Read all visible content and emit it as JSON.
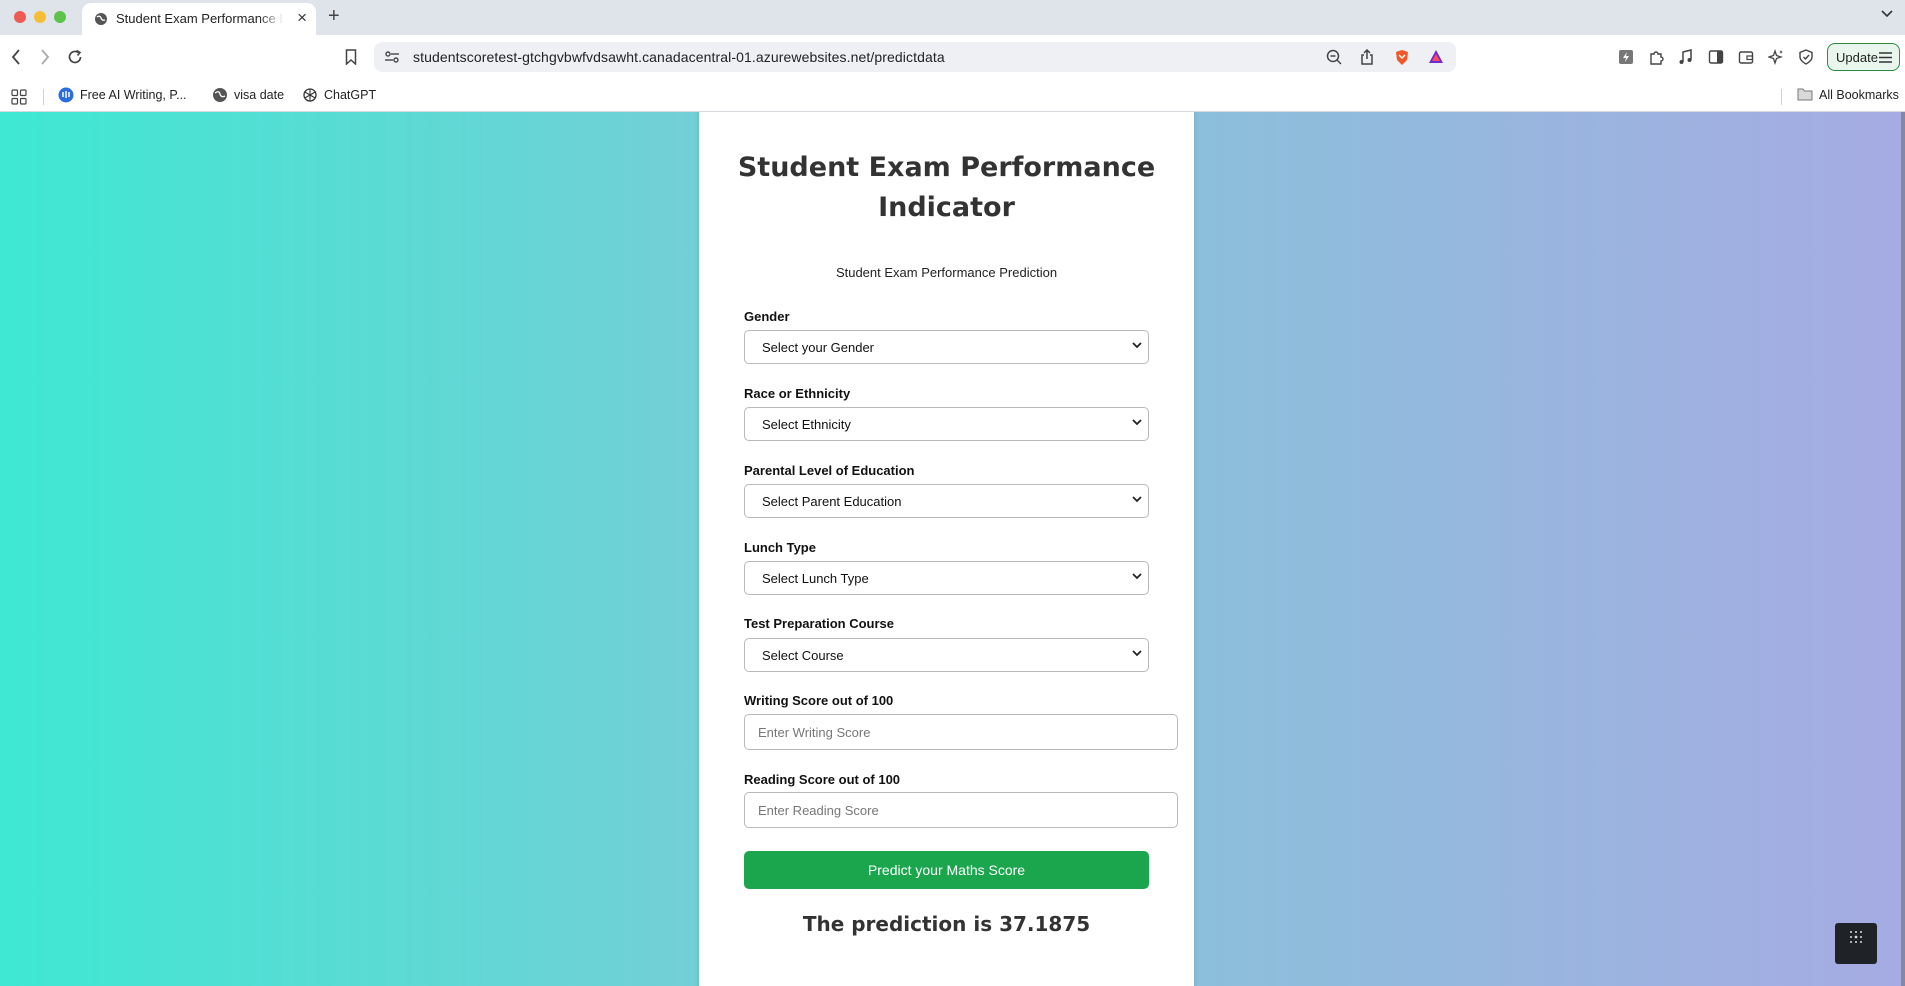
{
  "browser": {
    "tab": {
      "title": "Student Exam Performance Indicator"
    },
    "address_bar": {
      "url": "studentscoretest-gtchgvbwfvdsawht.canadacentral-01.azurewebsites.net/predictdata"
    },
    "update_button": {
      "label": "Update"
    },
    "bookmarks": [
      {
        "label": "Free AI Writing, P...",
        "icon": "ai-writing-icon"
      },
      {
        "label": "visa date",
        "icon": "globe-icon"
      },
      {
        "label": "ChatGPT",
        "icon": "chatgpt-icon"
      }
    ],
    "all_bookmarks": {
      "label": "All Bookmarks",
      "icon": "folder-icon"
    },
    "colors": {
      "update_border": "#2b8a3e"
    }
  },
  "page": {
    "title": "Student Exam Performance Indicator",
    "subtitle": "Student Exam Performance Prediction",
    "form": {
      "gender": {
        "label": "Gender",
        "value": "Select your Gender"
      },
      "ethnicity": {
        "label": "Race or Ethnicity",
        "value": "Select Ethnicity"
      },
      "parental_education": {
        "label": "Parental Level of Education",
        "value": "Select Parent Education"
      },
      "lunch": {
        "label": "Lunch Type",
        "value": "Select Lunch Type"
      },
      "test_prep": {
        "label": "Test Preparation Course",
        "value": "Select Course"
      },
      "writing_score": {
        "label": "Writing Score out of 100",
        "placeholder": "Enter Writing Score",
        "value": ""
      },
      "reading_score": {
        "label": "Reading Score out of 100",
        "placeholder": "Enter Reading Score",
        "value": ""
      },
      "submit_label": "Predict your Maths Score"
    },
    "result": "The prediction is 37.1875",
    "colors": {
      "gradient_start": "#3ee8d2",
      "gradient_end": "#a6abe3",
      "button": "#1ba64e"
    }
  }
}
